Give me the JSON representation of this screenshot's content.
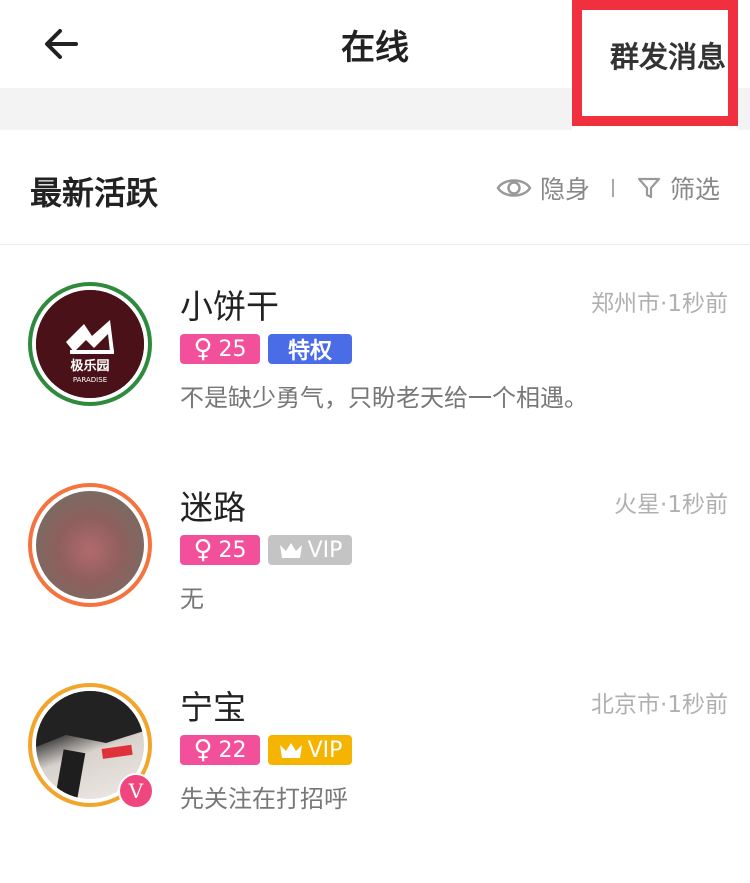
{
  "header": {
    "title": "在线",
    "mass_message": "群发消息",
    "back_icon": "back-arrow-icon"
  },
  "section": {
    "title": "最新活跃",
    "invisible_label": "隐身",
    "filter_label": "筛选"
  },
  "users": [
    {
      "name": "小饼干",
      "meta": "郑州市·1秒前",
      "gender": "♀",
      "age": "25",
      "tag": "特权",
      "tag_type": "privilege",
      "signature": "不是缺少勇气，只盼老天给一个相遇。",
      "ring_color": "#2e8b3e",
      "logo_text": "极乐园",
      "logo_sub": "PARADISE"
    },
    {
      "name": "迷路",
      "meta": "火星·1秒前",
      "gender": "♀",
      "age": "25",
      "tag": "VIP",
      "tag_type": "vip-gray",
      "signature": "无",
      "ring_color": "#f5733f"
    },
    {
      "name": "宁宝",
      "meta": "北京市·1秒前",
      "gender": "♀",
      "age": "22",
      "tag": "VIP",
      "tag_type": "vip-gold",
      "signature": "先关注在打招呼",
      "ring_color": "#f1a52b",
      "verified_mark": "V"
    }
  ],
  "colors": {
    "age_badge": "#f2509a",
    "privilege_badge": "#4a6ce6",
    "vip_gray": "#c4c4c4",
    "vip_gold": "#f5b400",
    "highlight_border": "#f0303e"
  }
}
